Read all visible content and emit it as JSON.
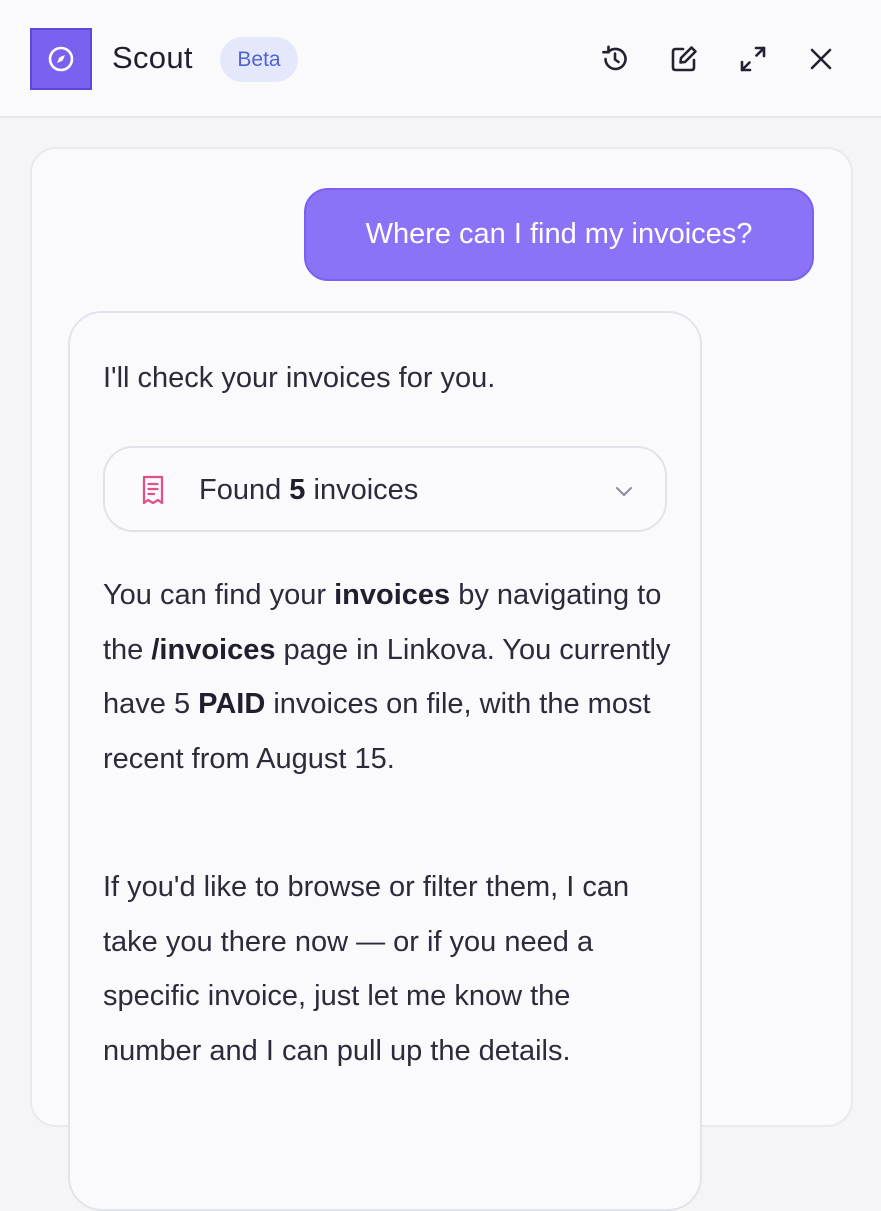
{
  "header": {
    "app_name": "Scout",
    "badge": "Beta",
    "icons": [
      "compass-icon",
      "history-icon",
      "edit-icon",
      "expand-icon",
      "close-icon"
    ]
  },
  "conversation": {
    "user_message": "Where can I find my invoices?",
    "bot_intro": "I'll check your invoices for you.",
    "tool_result": {
      "prefix": "Found",
      "count": "5",
      "suffix": "invoices",
      "icon": "receipt-icon"
    },
    "paragraph1": {
      "t1": "You can find your ",
      "b1": "invoices",
      "t2": " by navigating to the ",
      "b2": "/invoices",
      "t3": " page in Linkova. You currently have 5 ",
      "b3": "PAID",
      "t4": " invoices on file, with the most recent from August 15."
    },
    "paragraph2": "If you'd like to browse or filter them, I can take you there now — or if you need a specific invoice, just let me know the number and I can pull up the details."
  },
  "colors": {
    "accent": "#7b61f0",
    "user_bubble": "#8b72f7",
    "beta_bg": "#e5e8fb",
    "beta_text": "#4f63d6",
    "receipt_icon": "#e0508a"
  }
}
